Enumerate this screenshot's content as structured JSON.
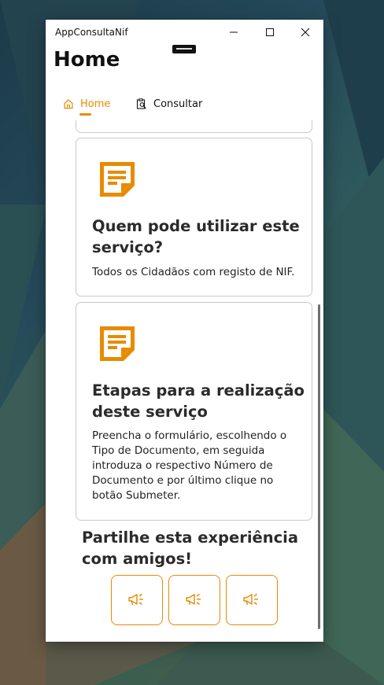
{
  "window": {
    "app_title": "AppConsultaNif",
    "page_title": "Home"
  },
  "tabs": [
    {
      "label": "Home",
      "icon": "home-icon",
      "active": true
    },
    {
      "label": "Consultar",
      "icon": "search-document-icon",
      "active": false
    }
  ],
  "cards": [
    {
      "title": "Quem pode utilizar este serviço?",
      "body": "Todos os Cidadãos com registo de NIF.",
      "icon": "document-lines-icon"
    },
    {
      "title": "Etapas para a realização deste serviço",
      "body": "Preencha o formulário, escolhendo o Tipo de Documento, em seguida introduza o respectivo Número de Documento e por último clique no botão Submeter.",
      "icon": "document-lines-icon"
    }
  ],
  "share": {
    "title": "Partilhe esta experiência com amigos!",
    "buttons": [
      {
        "icon": "megaphone-icon"
      },
      {
        "icon": "megaphone-icon"
      },
      {
        "icon": "megaphone-icon"
      }
    ]
  },
  "colors": {
    "accent": "#e88b00",
    "card_border": "#c9c9c9",
    "text": "#2b2b2b"
  }
}
